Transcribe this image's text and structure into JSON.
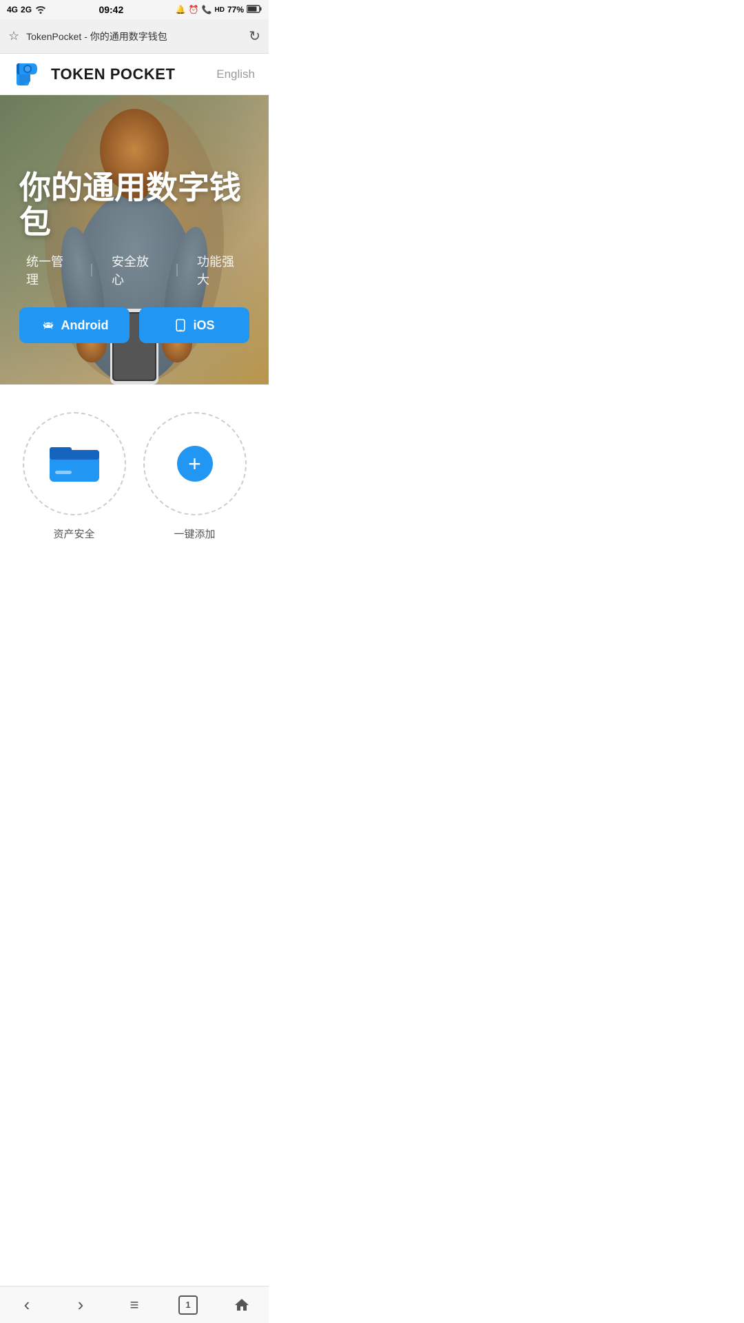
{
  "statusBar": {
    "signal": "4G 2G",
    "time": "09:42",
    "battery": "77%"
  },
  "browserBar": {
    "url": "TokenPocket - 你的通用数字钱包",
    "starIcon": "☆",
    "refreshIcon": "↻"
  },
  "navbar": {
    "logoText": "TOKEN POCKET",
    "langLabel": "English"
  },
  "hero": {
    "title": "你的通用数字钱包",
    "subtitleParts": [
      "统一管理",
      "安全放心",
      "功能强大"
    ],
    "androidBtn": "Android",
    "iosBtn": "iOS"
  },
  "features": [
    {
      "iconType": "wallet",
      "label": "资产安全"
    },
    {
      "iconType": "plus",
      "label": "一键添加"
    }
  ],
  "bottomNav": {
    "backLabel": "‹",
    "forwardLabel": "›",
    "menuLabel": "≡",
    "tabCount": "1",
    "homeLabel": "⌂"
  }
}
